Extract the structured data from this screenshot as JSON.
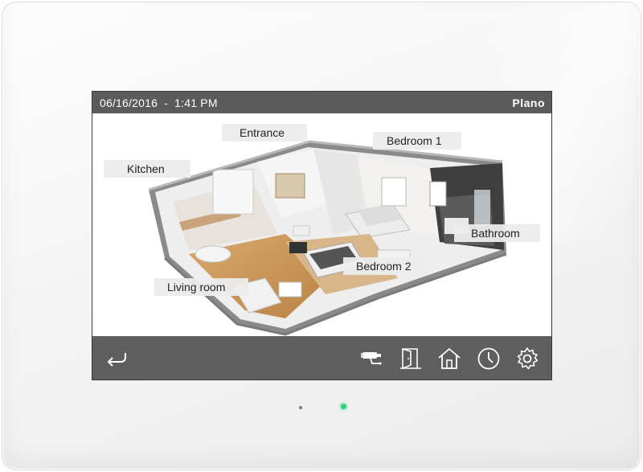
{
  "statusbar": {
    "date": "06/16/2016",
    "separator": "-",
    "time": "1:41 PM",
    "location": "Plano"
  },
  "rooms": {
    "entrance": "Entrance",
    "bedroom1": "Bedroom 1",
    "kitchen": "Kitchen",
    "bathroom": "Bathroom",
    "bedroom2": "Bedroom 2",
    "living_room": "Living room"
  },
  "toolbar": {
    "icons": [
      "back-arrow-icon",
      "camera-icon",
      "door-icon",
      "home-icon",
      "clock-icon",
      "gear-icon"
    ]
  },
  "colors": {
    "bar": "#5b5b5b",
    "label_bg": "#ececec",
    "status_led": "#2fd07c"
  }
}
